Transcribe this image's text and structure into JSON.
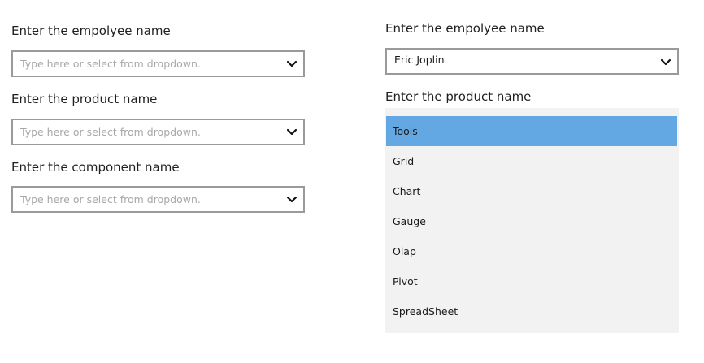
{
  "left_form": {
    "employee_label": "Enter the empolyee name",
    "employee_placeholder": "Type here or select from dropdown.",
    "product_label": "Enter the product name",
    "product_placeholder": "Type here or select from dropdown.",
    "component_label": "Enter the component name",
    "component_placeholder": "Type here or select from dropdown."
  },
  "right_form": {
    "employee_label": "Enter the empolyee name",
    "employee_value": "Eric Joplin",
    "product_label": "Enter the product name",
    "dropdown": {
      "selected_index": 0,
      "options": [
        "Tools",
        "Grid",
        "Chart",
        "Gauge",
        "Olap",
        "Pivot",
        "SpreadSheet"
      ]
    }
  },
  "icons": {
    "chevron": "chevron-down-icon"
  }
}
